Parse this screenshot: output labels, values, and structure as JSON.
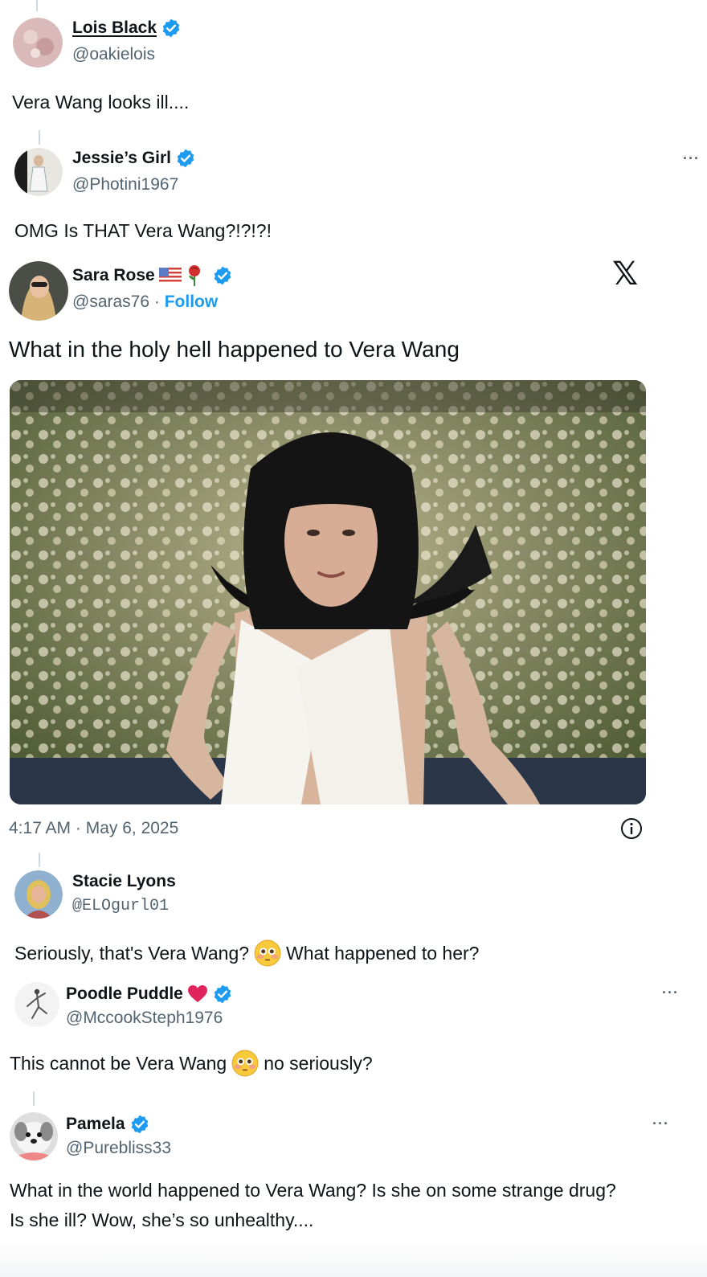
{
  "replies_top": [
    {
      "name": "Lois Black",
      "handle": "@oakielois",
      "text": "Vera Wang looks ill...."
    },
    {
      "name": "Jessie’s Girl",
      "handle": "@Photini1967",
      "text": "OMG Is THAT Vera Wang?!?!?!",
      "more": "···"
    }
  ],
  "main_post": {
    "name": "Sara Rose",
    "handle": "@saras76",
    "separator": "·",
    "follow_label": "Follow",
    "platform_logo": "𝕏",
    "text": "What in the holy hell happened to Vera Wang",
    "timestamp": "4:17 AM · May 6, 2025",
    "icons": [
      "flag-us-icon",
      "rose-icon",
      "verified-badge-icon",
      "info-icon"
    ]
  },
  "replies_bottom": [
    {
      "name": "Stacie Lyons",
      "handle": "@ELOgurl01",
      "text_before": "Seriously, that's Vera Wang?",
      "emoji": "flushed-face",
      "text_after": "What happened to her?"
    },
    {
      "name": "Poodle Puddle",
      "handle": "@MccookSteph1976",
      "text_before": "This cannot be Vera Wang",
      "emoji": "flushed-face",
      "text_after": "no seriously?",
      "more": "···"
    },
    {
      "name": "Pamela",
      "handle": "@Purebliss33",
      "text_line1": "What in the world happened to Vera Wang? Is she on some strange drug?",
      "text_line2": "Is she ill? Wow, she’s so unhealthy....",
      "more": "···"
    }
  ],
  "colors": {
    "text": "#0f1419",
    "secondary": "#536471",
    "accent": "#1d9bf0",
    "verified": "#1d9bf0",
    "heart": "#e0245e"
  }
}
